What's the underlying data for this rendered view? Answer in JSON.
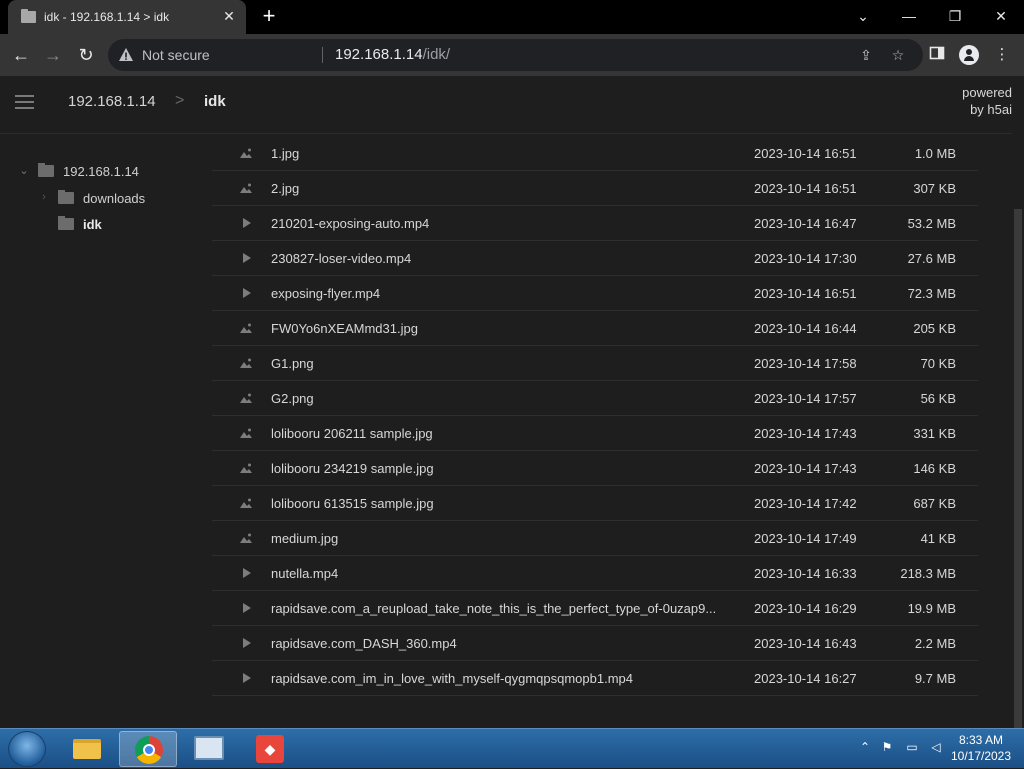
{
  "browser": {
    "tab_title": "idk - 192.168.1.14 > idk",
    "security_label": "Not secure",
    "url_host": "192.168.1.14",
    "url_path": "/idk/"
  },
  "header": {
    "root": "192.168.1.14",
    "separator": ">",
    "current": "idk",
    "powered_line1": "powered",
    "powered_line2": "by h5ai"
  },
  "tree": [
    {
      "label": "192.168.1.14",
      "expanded": true,
      "level": 0
    },
    {
      "label": "downloads",
      "expanded": false,
      "level": 1
    },
    {
      "label": "idk",
      "expanded": false,
      "level": 1,
      "current": true
    }
  ],
  "files": [
    {
      "name": "1.jpg",
      "type": "image",
      "date": "2023-10-14 16:51",
      "size": "1.0 MB"
    },
    {
      "name": "2.jpg",
      "type": "image",
      "date": "2023-10-14 16:51",
      "size": "307 KB"
    },
    {
      "name": "210201-exposing-auto.mp4",
      "type": "video",
      "date": "2023-10-14 16:47",
      "size": "53.2 MB"
    },
    {
      "name": "230827-loser-video.mp4",
      "type": "video",
      "date": "2023-10-14 17:30",
      "size": "27.6 MB"
    },
    {
      "name": "exposing-flyer.mp4",
      "type": "video",
      "date": "2023-10-14 16:51",
      "size": "72.3 MB"
    },
    {
      "name": "FW0Yo6nXEAMmd31.jpg",
      "type": "image",
      "date": "2023-10-14 16:44",
      "size": "205 KB"
    },
    {
      "name": "G1.png",
      "type": "image",
      "date": "2023-10-14 17:58",
      "size": "70 KB"
    },
    {
      "name": "G2.png",
      "type": "image",
      "date": "2023-10-14 17:57",
      "size": "56 KB"
    },
    {
      "name": "lolibooru 206211 sample.jpg",
      "type": "image",
      "date": "2023-10-14 17:43",
      "size": "331 KB"
    },
    {
      "name": "lolibooru 234219 sample.jpg",
      "type": "image",
      "date": "2023-10-14 17:43",
      "size": "146 KB"
    },
    {
      "name": "lolibooru 613515 sample.jpg",
      "type": "image",
      "date": "2023-10-14 17:42",
      "size": "687 KB"
    },
    {
      "name": "medium.jpg",
      "type": "image",
      "date": "2023-10-14 17:49",
      "size": "41 KB"
    },
    {
      "name": "nutella.mp4",
      "type": "video",
      "date": "2023-10-14 16:33",
      "size": "218.3 MB"
    },
    {
      "name": "rapidsave.com_a_reupload_take_note_this_is_the_perfect_type_of-0uzap9...",
      "type": "video",
      "date": "2023-10-14 16:29",
      "size": "19.9 MB"
    },
    {
      "name": "rapidsave.com_DASH_360.mp4",
      "type": "video",
      "date": "2023-10-14 16:43",
      "size": "2.2 MB"
    },
    {
      "name": "rapidsave.com_im_in_love_with_myself-qygmqpsqmopb1.mp4",
      "type": "video",
      "date": "2023-10-14 16:27",
      "size": "9.7 MB"
    }
  ],
  "taskbar": {
    "time": "8:33 AM",
    "date": "10/17/2023",
    "apps": [
      "windows-explorer",
      "google-chrome",
      "remote-desktop",
      "anydesk"
    ],
    "active_app": "google-chrome"
  },
  "colors": {
    "page_bg": "#1e1e1e",
    "text": "#d7d7d7",
    "row_border": "#2e2e2e",
    "taskbar": "#1b4f86"
  }
}
